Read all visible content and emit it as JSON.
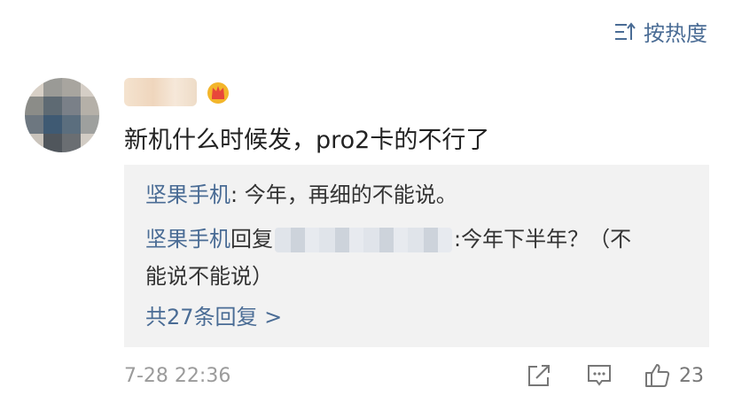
{
  "sort": {
    "label": "按热度",
    "icon": "sort-icon"
  },
  "comment": {
    "text": "新机什么时候发，pro2卡的不行了",
    "timestamp": "7-28 22:36",
    "like_count": "23"
  },
  "replies": [
    {
      "author": "坚果手机",
      "separator": ":",
      "text": " 今年，再细的不能说。"
    },
    {
      "author": "坚果手机",
      "verb": "回复",
      "separator": ":",
      "text_line1": "今年下半年？（不",
      "text_line2": "能说不能说）"
    }
  ],
  "more_replies": "共27条回复 >",
  "colors": {
    "link": "#4a6c95",
    "reply_bg": "#f2f2f2",
    "meta": "#9b9b9b"
  }
}
